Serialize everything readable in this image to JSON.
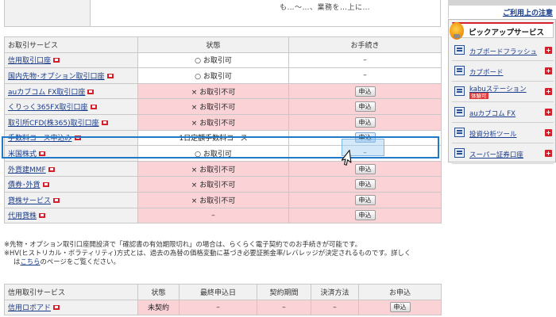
{
  "top_fragment": {
    "text": "も…～…、業務を…上に…"
  },
  "services_table": {
    "headers": [
      "お取引サービス",
      "状態",
      "お手続き"
    ],
    "rows": [
      {
        "name": "信用取引口座",
        "status": "○ お取引可",
        "action": "–",
        "state": "ok"
      },
      {
        "name": "国内先物･オプション取引口座",
        "status": "○ お取引可",
        "action": "–",
        "state": "ok"
      },
      {
        "name": "auカブコム FX取引口座",
        "status": "× お取引不可",
        "action": "申込",
        "state": "ng"
      },
      {
        "name": "くりっく365FX取引口座",
        "status": "× お取引不可",
        "action": "申込",
        "state": "ng"
      },
      {
        "name": "取引所CFD(株365)取引口座",
        "status": "× お取引不可",
        "action": "申込",
        "state": "ng"
      },
      {
        "name": "手数料コース申込み",
        "status": "1日定額手数料コース",
        "action": "申込",
        "state": "hl"
      },
      {
        "name": "米国株式",
        "status": "○ お取引可",
        "action": "–",
        "state": "ok"
      },
      {
        "name": "外貨建MMF",
        "status": "× お取引不可",
        "action": "申込",
        "state": "ng"
      },
      {
        "name": "債券･外貨",
        "status": "× お取引不可",
        "action": "申込",
        "state": "ng"
      },
      {
        "name": "貸株サービス",
        "status": "× お取引不可",
        "action": "申込",
        "state": "ng"
      },
      {
        "name": "代用貸株",
        "status": "–",
        "action": "申込",
        "state": "ng"
      }
    ]
  },
  "notes": {
    "line1": "※先物・オプション取引口座開設済で「確認書の有効期限切れ」の場合は、らくらく電子契約でのお手続きが可能です。",
    "line2": "※HV(ヒストリカル・ボラティリティ)方式とは、過去の為替の価格変動に基づき必要証拠金率/レバレッジが決定されるものです。詳しく",
    "line3_pre": "は",
    "line3_link": "こちら",
    "line3_post": "のページをご覧ください。"
  },
  "credit_table": {
    "headers": [
      "信用取引サービス",
      "状態",
      "最終申込日",
      "契約期間",
      "決済方法",
      "お申込"
    ],
    "row": {
      "name": "信用ロボアド",
      "status": "未契約",
      "last_date": "–",
      "period": "–",
      "settlement": "–",
      "action": "申込"
    }
  },
  "sidebar": {
    "notice": "ご利用上の注意",
    "pickup_title": "ピックアップサービス",
    "items": [
      {
        "label": "カブボードフラッシュ"
      },
      {
        "label": "カブボード"
      },
      {
        "label": "kabuステーション",
        "tag": "体験可"
      },
      {
        "label": "auカブコム FX"
      },
      {
        "label": "投資分析ツール"
      },
      {
        "label": "スーパー証券口座"
      }
    ]
  },
  "colors": {
    "link": "#1a3c8c",
    "unavailable_bg": "#fbd3d7",
    "label_bg": "#f1f1f1",
    "highlight": "#1f79c7",
    "brand_red": "#d4202a"
  }
}
